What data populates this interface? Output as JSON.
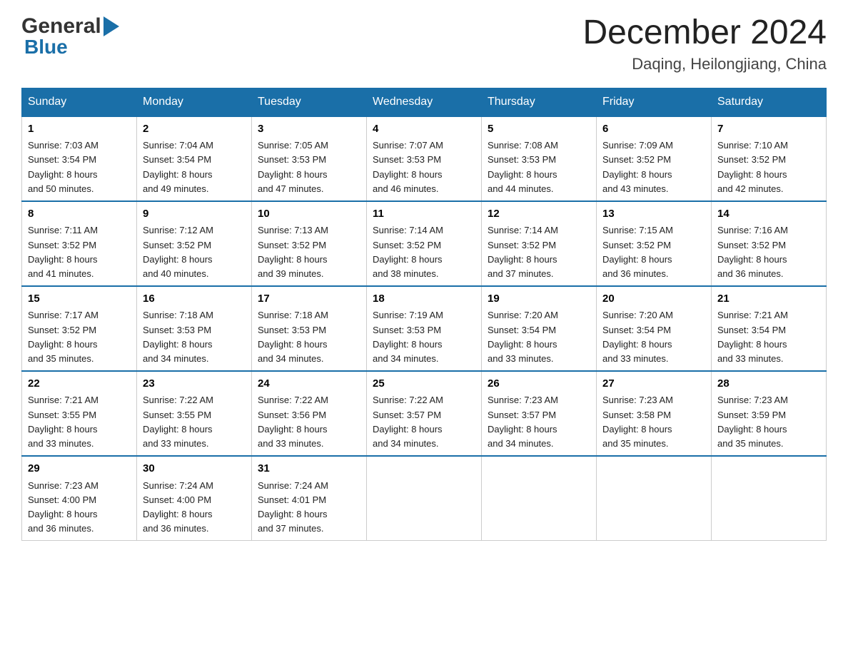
{
  "header": {
    "logo_general": "General",
    "logo_blue": "Blue",
    "month_title": "December 2024",
    "location": "Daqing, Heilongjiang, China"
  },
  "weekdays": [
    "Sunday",
    "Monday",
    "Tuesday",
    "Wednesday",
    "Thursday",
    "Friday",
    "Saturday"
  ],
  "weeks": [
    [
      {
        "day": "1",
        "sunrise": "7:03 AM",
        "sunset": "3:54 PM",
        "daylight": "8 hours and 50 minutes."
      },
      {
        "day": "2",
        "sunrise": "7:04 AM",
        "sunset": "3:54 PM",
        "daylight": "8 hours and 49 minutes."
      },
      {
        "day": "3",
        "sunrise": "7:05 AM",
        "sunset": "3:53 PM",
        "daylight": "8 hours and 47 minutes."
      },
      {
        "day": "4",
        "sunrise": "7:07 AM",
        "sunset": "3:53 PM",
        "daylight": "8 hours and 46 minutes."
      },
      {
        "day": "5",
        "sunrise": "7:08 AM",
        "sunset": "3:53 PM",
        "daylight": "8 hours and 44 minutes."
      },
      {
        "day": "6",
        "sunrise": "7:09 AM",
        "sunset": "3:52 PM",
        "daylight": "8 hours and 43 minutes."
      },
      {
        "day": "7",
        "sunrise": "7:10 AM",
        "sunset": "3:52 PM",
        "daylight": "8 hours and 42 minutes."
      }
    ],
    [
      {
        "day": "8",
        "sunrise": "7:11 AM",
        "sunset": "3:52 PM",
        "daylight": "8 hours and 41 minutes."
      },
      {
        "day": "9",
        "sunrise": "7:12 AM",
        "sunset": "3:52 PM",
        "daylight": "8 hours and 40 minutes."
      },
      {
        "day": "10",
        "sunrise": "7:13 AM",
        "sunset": "3:52 PM",
        "daylight": "8 hours and 39 minutes."
      },
      {
        "day": "11",
        "sunrise": "7:14 AM",
        "sunset": "3:52 PM",
        "daylight": "8 hours and 38 minutes."
      },
      {
        "day": "12",
        "sunrise": "7:14 AM",
        "sunset": "3:52 PM",
        "daylight": "8 hours and 37 minutes."
      },
      {
        "day": "13",
        "sunrise": "7:15 AM",
        "sunset": "3:52 PM",
        "daylight": "8 hours and 36 minutes."
      },
      {
        "day": "14",
        "sunrise": "7:16 AM",
        "sunset": "3:52 PM",
        "daylight": "8 hours and 36 minutes."
      }
    ],
    [
      {
        "day": "15",
        "sunrise": "7:17 AM",
        "sunset": "3:52 PM",
        "daylight": "8 hours and 35 minutes."
      },
      {
        "day": "16",
        "sunrise": "7:18 AM",
        "sunset": "3:53 PM",
        "daylight": "8 hours and 34 minutes."
      },
      {
        "day": "17",
        "sunrise": "7:18 AM",
        "sunset": "3:53 PM",
        "daylight": "8 hours and 34 minutes."
      },
      {
        "day": "18",
        "sunrise": "7:19 AM",
        "sunset": "3:53 PM",
        "daylight": "8 hours and 34 minutes."
      },
      {
        "day": "19",
        "sunrise": "7:20 AM",
        "sunset": "3:54 PM",
        "daylight": "8 hours and 33 minutes."
      },
      {
        "day": "20",
        "sunrise": "7:20 AM",
        "sunset": "3:54 PM",
        "daylight": "8 hours and 33 minutes."
      },
      {
        "day": "21",
        "sunrise": "7:21 AM",
        "sunset": "3:54 PM",
        "daylight": "8 hours and 33 minutes."
      }
    ],
    [
      {
        "day": "22",
        "sunrise": "7:21 AM",
        "sunset": "3:55 PM",
        "daylight": "8 hours and 33 minutes."
      },
      {
        "day": "23",
        "sunrise": "7:22 AM",
        "sunset": "3:55 PM",
        "daylight": "8 hours and 33 minutes."
      },
      {
        "day": "24",
        "sunrise": "7:22 AM",
        "sunset": "3:56 PM",
        "daylight": "8 hours and 33 minutes."
      },
      {
        "day": "25",
        "sunrise": "7:22 AM",
        "sunset": "3:57 PM",
        "daylight": "8 hours and 34 minutes."
      },
      {
        "day": "26",
        "sunrise": "7:23 AM",
        "sunset": "3:57 PM",
        "daylight": "8 hours and 34 minutes."
      },
      {
        "day": "27",
        "sunrise": "7:23 AM",
        "sunset": "3:58 PM",
        "daylight": "8 hours and 35 minutes."
      },
      {
        "day": "28",
        "sunrise": "7:23 AM",
        "sunset": "3:59 PM",
        "daylight": "8 hours and 35 minutes."
      }
    ],
    [
      {
        "day": "29",
        "sunrise": "7:23 AM",
        "sunset": "4:00 PM",
        "daylight": "8 hours and 36 minutes."
      },
      {
        "day": "30",
        "sunrise": "7:24 AM",
        "sunset": "4:00 PM",
        "daylight": "8 hours and 36 minutes."
      },
      {
        "day": "31",
        "sunrise": "7:24 AM",
        "sunset": "4:01 PM",
        "daylight": "8 hours and 37 minutes."
      },
      null,
      null,
      null,
      null
    ]
  ],
  "labels": {
    "sunrise": "Sunrise:",
    "sunset": "Sunset:",
    "daylight": "Daylight:"
  },
  "colors": {
    "header_bg": "#1a6fa8",
    "header_text": "#ffffff",
    "border_top": "#1a6fa8"
  }
}
